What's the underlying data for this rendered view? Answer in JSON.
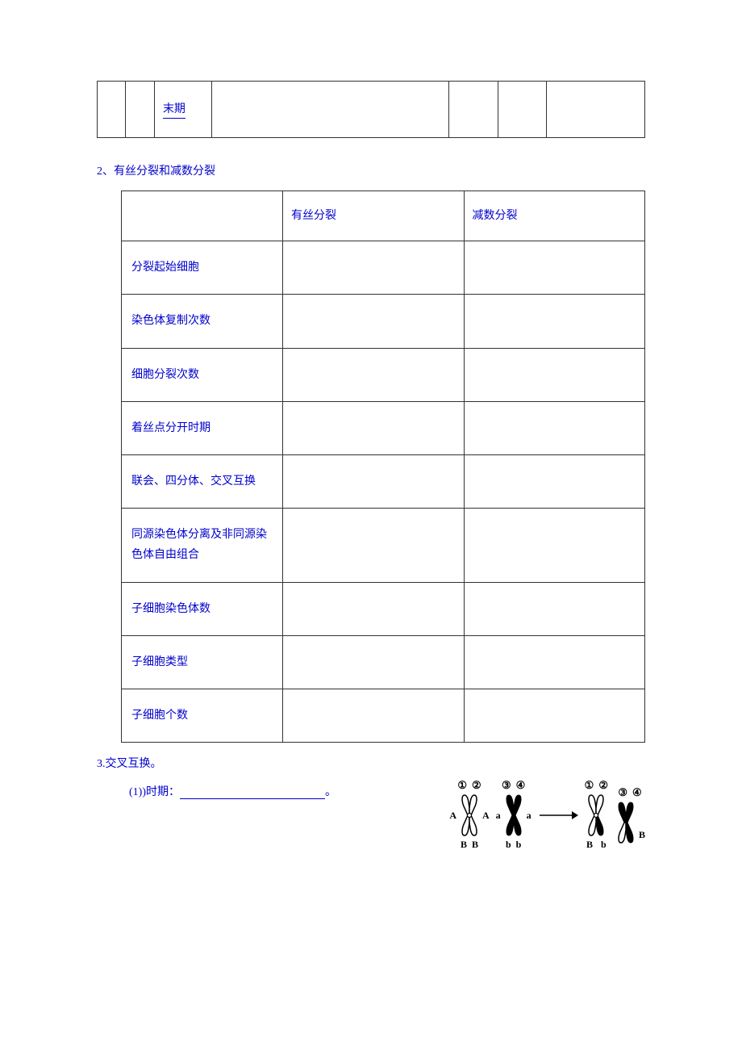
{
  "table1": {
    "cell_text": "末期"
  },
  "section2": {
    "title": "2、有丝分裂和减数分裂",
    "header1": "有丝分裂",
    "header2": "减数分裂",
    "rows": [
      "分裂起始细胞",
      "染色体复制次数",
      "细胞分裂次数",
      "着丝点分开时期",
      "联会、四分体、交叉互换",
      "同源染色体分离及非同源染色体自由组合",
      "子细胞染色体数",
      "子细胞类型",
      "子细胞个数"
    ]
  },
  "section3": {
    "title": "3.交叉互换。",
    "q1": "(1))时期：",
    "period": "。"
  },
  "diagram": {
    "labels_top_1": [
      "①",
      "②"
    ],
    "labels_top_2": [
      "③",
      "④"
    ],
    "label_A": "A",
    "label_a": "a",
    "label_B": "B",
    "label_b": "b"
  }
}
